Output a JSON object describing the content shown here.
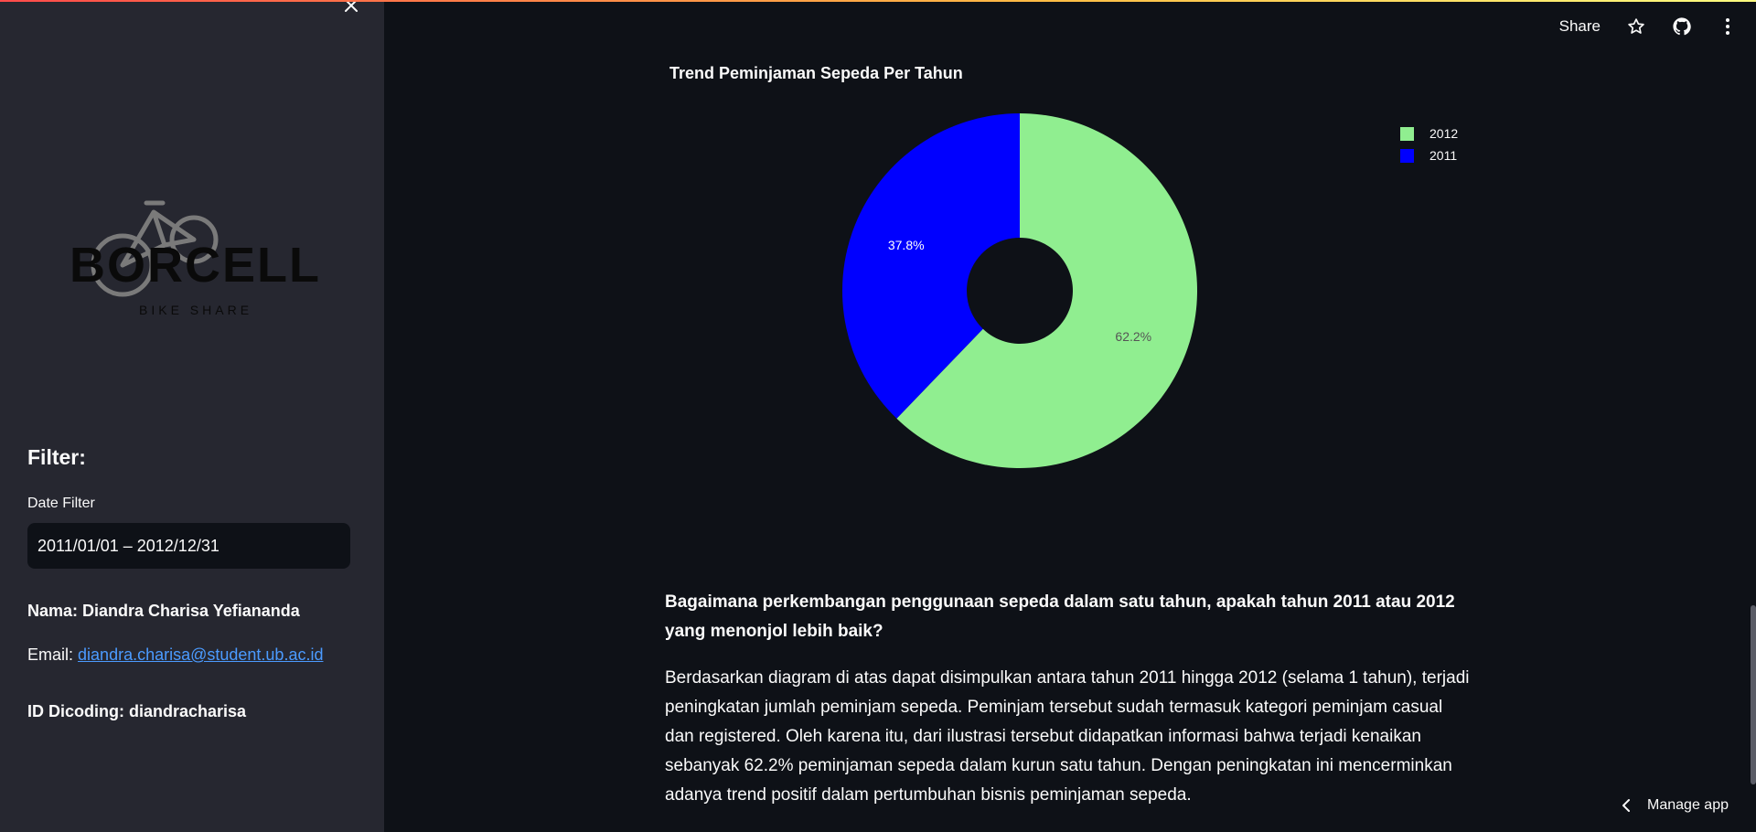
{
  "header": {
    "share_label": "Share",
    "icons": [
      "star-icon",
      "github-icon",
      "more-vertical-icon"
    ]
  },
  "sidebar": {
    "logo": {
      "brand": "BORCELLE",
      "tagline": "BIKE SHARE"
    },
    "filter_title": "Filter:",
    "date_filter_label": "Date Filter",
    "date_filter_value": "2011/01/01 – 2012/12/31",
    "name_text": "Nama: Diandra Charisa Yefiananda",
    "email_label": "Email:",
    "email_value": "diandra.charisa@student.ub.ac.id",
    "dicoding_text": "ID Dicoding: diandracharisa"
  },
  "main": {
    "chart_title": "Trend Peminjaman Sepeda Per Tahun",
    "question": "Bagaimana perkembangan penggunaan sepeda dalam satu tahun, apakah tahun 2011 atau 2012 yang menonjol lebih baik?",
    "answer": "Berdasarkan diagram di atas dapat disimpulkan antara tahun 2011 hingga 2012 (selama 1 tahun), terjadi peningkatan jumlah peminjam sepeda. Peminjam tersebut sudah termasuk kategori peminjam casual dan registered. Oleh karena itu, dari ilustrasi tersebut didapatkan informasi bahwa terjadi kenaikan sebanyak 62.2% peminjaman sepeda dalam kurun satu tahun. Dengan peningkatan ini mencerminkan adanya trend positif dalam pertumbuhan bisnis peminjaman sepeda."
  },
  "chart_data": {
    "type": "pie",
    "hole": true,
    "title": "Trend Peminjaman Sepeda Per Tahun",
    "legend_position": "top-right",
    "slices": [
      {
        "label": "2012",
        "value": 62.2,
        "text": "62.2%",
        "color": "#90ee90",
        "text_color": "#555555"
      },
      {
        "label": "2011",
        "value": 37.8,
        "text": "37.8%",
        "color": "#0000ff",
        "text_color": "#ffffff"
      }
    ]
  },
  "footer": {
    "manage_label": "Manage app"
  },
  "colors": {
    "background": "#0e1117",
    "sidebar": "#262730",
    "link": "#4b9bff"
  }
}
